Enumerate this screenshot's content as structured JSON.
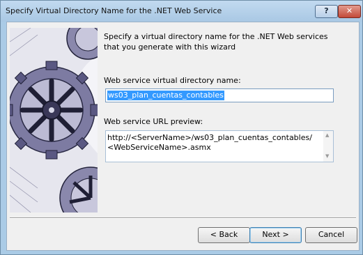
{
  "window": {
    "title": "Specify Virtual Directory Name for the .NET Web Service"
  },
  "titlebar": {
    "help_label": "?",
    "close_label": "✕"
  },
  "description": "Specify a virtual directory name for the .NET Web services that you generate with this wizard",
  "vdir": {
    "label": "Web service virtual directory name:",
    "value": "ws03_plan_cuentas_contables"
  },
  "preview": {
    "label": "Web service URL preview:",
    "value": "http://<ServerName>/ws03_plan_cuentas_contables/<WebServiceName>.asmx"
  },
  "buttons": {
    "back": "< Back",
    "next": "Next >",
    "cancel": "Cancel"
  },
  "colors": {
    "titlebar": "#aacbe6",
    "selection": "#3399ff",
    "close": "#c24a3a"
  },
  "icons": {
    "art": "gears-artwork",
    "help": "help-icon",
    "close": "close-icon"
  }
}
